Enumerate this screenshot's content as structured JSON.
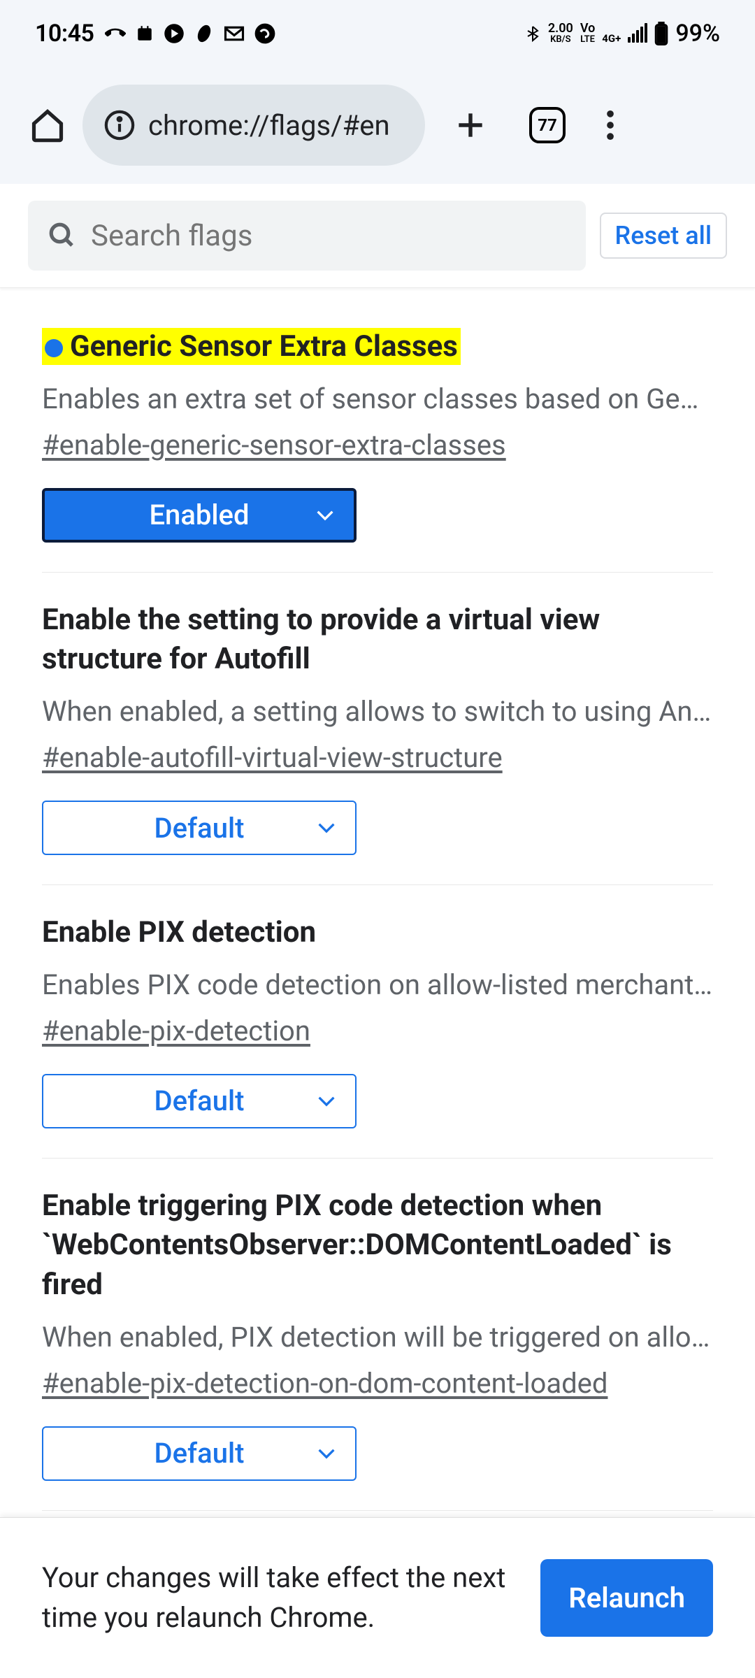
{
  "status_bar": {
    "time": "10:45",
    "network_speed": "2.00",
    "network_unit": "KB/S",
    "volte": "Vo",
    "lte": "LTE",
    "signal_label": "4G+",
    "battery_percent": "99%"
  },
  "browser": {
    "url": "chrome://flags/#en",
    "tab_count": "77"
  },
  "search": {
    "placeholder": "Search flags",
    "reset_label": "Reset all"
  },
  "flags": [
    {
      "title": "Generic Sensor Extra Classes",
      "highlighted": true,
      "modified": true,
      "description": "Enables an extra set of sensor classes based on Gen…",
      "anchor": "#enable-generic-sensor-extra-classes",
      "selected": "Enabled",
      "state": "enabled"
    },
    {
      "title": "Enable the setting to provide a virtual view structure for Autofill",
      "highlighted": false,
      "modified": false,
      "description": "When enabled, a setting allows to switch to using An…",
      "anchor": "#enable-autofill-virtual-view-structure",
      "selected": "Default",
      "state": "default"
    },
    {
      "title": "Enable PIX detection",
      "highlighted": false,
      "modified": false,
      "description": "Enables PIX code detection on allow-listed merchant …",
      "anchor": "#enable-pix-detection",
      "selected": "Default",
      "state": "default"
    },
    {
      "title": "Enable triggering PIX code detection when `WebContentsObserver::DOMContentLoaded` is fired",
      "highlighted": false,
      "modified": false,
      "description": "When enabled, PIX detection will be triggered on allo…",
      "anchor": "#enable-pix-detection-on-dom-content-loaded",
      "selected": "Default",
      "state": "default"
    }
  ],
  "relaunch": {
    "message": "Your changes will take effect the next time you relaunch Chrome.",
    "button_label": "Relaunch"
  }
}
